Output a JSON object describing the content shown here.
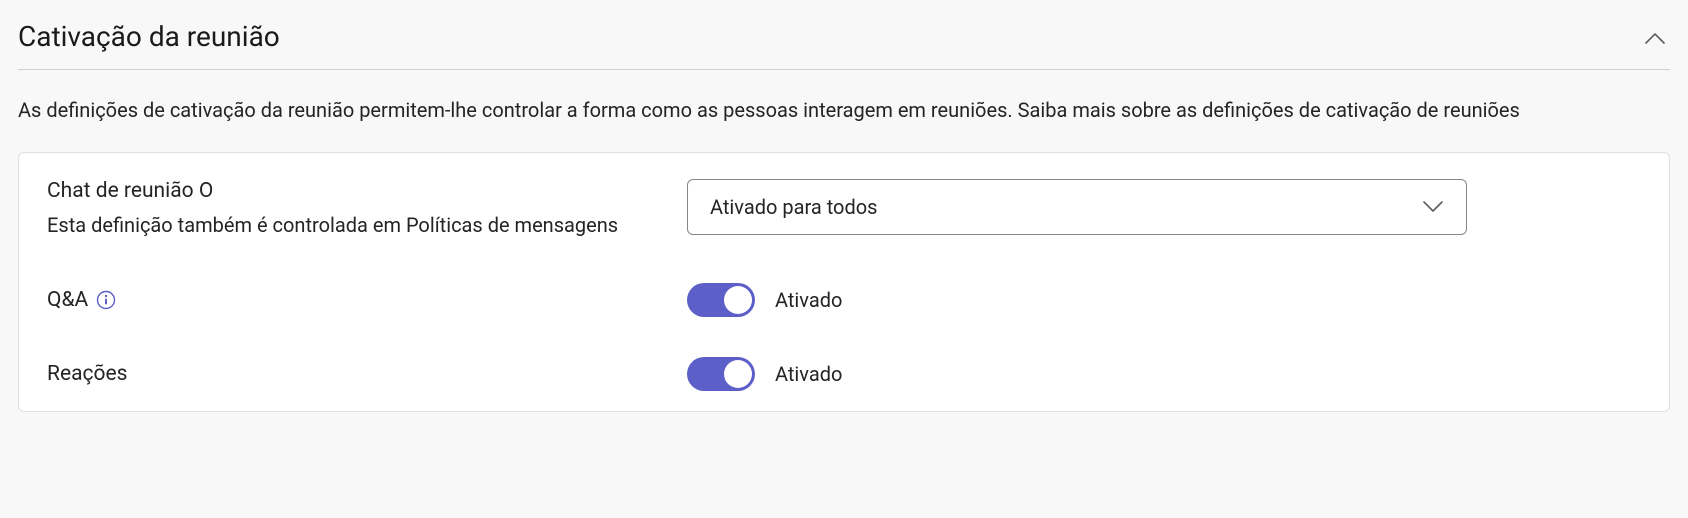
{
  "section": {
    "title": "Cativação da reunião",
    "description_part1": "As definições de cativação da reunião permitem-lhe controlar a forma como as pessoas interagem em reuniões. ",
    "description_link": "Saiba mais sobre as definições de cativação de reuniões"
  },
  "settings": {
    "meeting_chat": {
      "label": "Chat de reunião O",
      "sublabel": "Esta definição também é controlada em Políticas de mensagens",
      "value": "Ativado para todos"
    },
    "qa": {
      "label": "Q&A",
      "status": "Ativado"
    },
    "reactions": {
      "label": "Reações",
      "status": "Ativado"
    }
  }
}
